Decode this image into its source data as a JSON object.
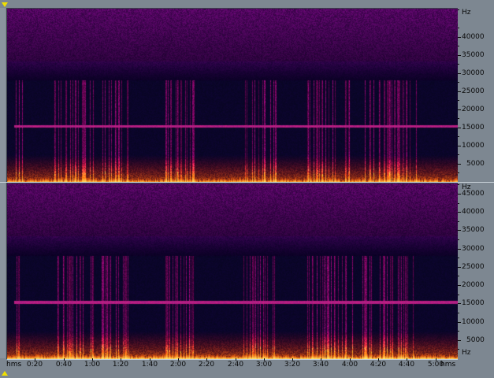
{
  "channel1": {
    "name": "spectrogram-channel-1",
    "unit_label": "Hz",
    "freq_ticks": [
      "40000",
      "35000",
      "30000",
      "25000",
      "20000",
      "15000",
      "10000",
      "5000"
    ],
    "max_freq": 48000
  },
  "channel2": {
    "name": "spectrogram-channel-2",
    "unit_label": "Hz",
    "freq_ticks": [
      "45000",
      "40000",
      "35000",
      "30000",
      "25000",
      "20000",
      "15000",
      "10000",
      "5000"
    ],
    "max_freq": 48000
  },
  "timeline": {
    "unit_left": "hms",
    "unit_right": "hms",
    "labels": [
      "0:20",
      "0:40",
      "1:00",
      "1:20",
      "1:40",
      "2:00",
      "2:20",
      "2:40",
      "3:00",
      "3:20",
      "3:40",
      "4:00",
      "4:20",
      "4:40",
      "5:00"
    ],
    "total_seconds": 315
  },
  "colors": {
    "background": "#7d8791",
    "marker": "#f0e000",
    "spectrum_low": "#020218",
    "spectrum_mid": "#7a1580",
    "spectrum_high": "#ffd000"
  }
}
